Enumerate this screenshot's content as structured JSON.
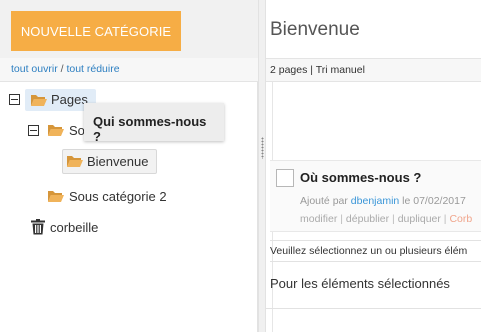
{
  "left": {
    "new_category_label": "NOUVELLE CATÉGORIE",
    "open_all": "tout ouvrir",
    "separator": " / ",
    "collapse_all": "tout réduire"
  },
  "tree": {
    "pages": "Pages",
    "sous_categorie_1_partial": "So",
    "bienvenue": "Bienvenue",
    "sous_categorie_2": "Sous catégorie 2",
    "corbeille": "corbeille"
  },
  "tooltip": {
    "text": "Qui sommes-nous ?"
  },
  "right": {
    "title": "Bienvenue",
    "bar_text": "2 pages | Tri manuel",
    "item": {
      "title": "Où sommes-nous ?",
      "meta_prefix": "Ajouté par ",
      "author": "dbenjamin",
      "meta_suffix": " le 07/02/2017",
      "actions": [
        "modifier",
        "dépublier",
        "dupliquer",
        "Corb"
      ],
      "sep": " | "
    },
    "select_message": "Veuillez sélectionnez un ou plusieurs élém",
    "selected_heading": "Pour les éléments sélectionnés"
  },
  "colors": {
    "accent": "#f6ad45",
    "link": "#2d7fc1",
    "highlight": "#e1ecf7",
    "folder": "#e8a849"
  }
}
